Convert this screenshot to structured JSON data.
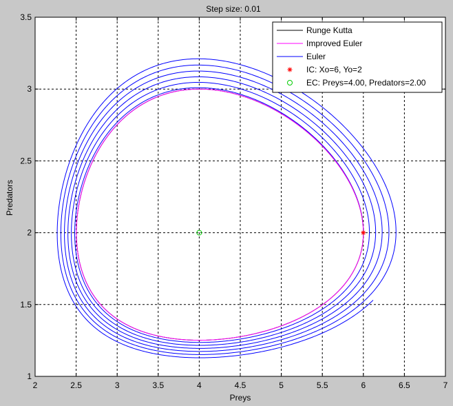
{
  "chart_data": {
    "type": "line",
    "title": "Step size: 0.01",
    "xlabel": "Preys",
    "ylabel": "Predators",
    "xlim": [
      2,
      7
    ],
    "ylim": [
      1,
      3.5
    ],
    "xticks": [
      "2",
      "2.5",
      "3",
      "3.5",
      "4",
      "4.5",
      "5",
      "5.5",
      "6",
      "6.5",
      "7"
    ],
    "yticks": [
      "1",
      "1.5",
      "2",
      "2.5",
      "3",
      "3.5"
    ],
    "grid": true,
    "legend_position": "top-right",
    "series": [
      {
        "name": "Runge Kutta",
        "color": "#000000",
        "style": "line",
        "model": "lotka-volterra",
        "x0": 6,
        "y0": 2,
        "step": 0.01,
        "method": "rk4"
      },
      {
        "name": "Improved Euler",
        "color": "#ff00ff",
        "style": "line",
        "model": "lotka-volterra",
        "x0": 6,
        "y0": 2,
        "step": 0.01,
        "method": "heun"
      },
      {
        "name": "Euler",
        "color": "#0000ff",
        "style": "line",
        "model": "lotka-volterra",
        "x0": 6,
        "y0": 2,
        "step": 0.01,
        "method": "euler",
        "t_end": 38
      },
      {
        "name": "IC: Xo=6, Yo=2",
        "color": "#ff0000",
        "style": "marker-star",
        "x": [
          6
        ],
        "y": [
          2
        ]
      },
      {
        "name": "EC: Preys=4.00, Predators=2.00",
        "color": "#00cc00",
        "style": "marker-circle",
        "x": [
          4
        ],
        "y": [
          2
        ]
      }
    ]
  }
}
